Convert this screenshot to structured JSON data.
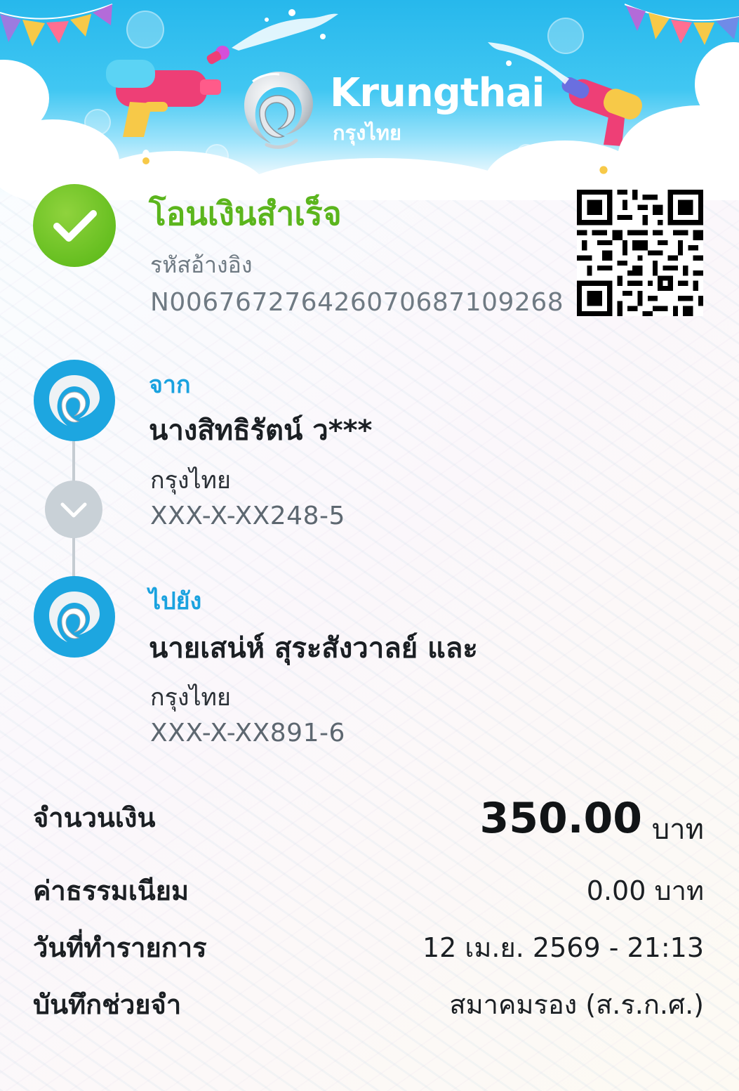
{
  "brand": {
    "name_en": "Krungthai",
    "name_th": "กรุงไทย"
  },
  "status": {
    "title": "โอนเงินสำเร็จ",
    "ref_label": "รหัสอ้างอิง",
    "ref_number": "N006767276426070687109268"
  },
  "from": {
    "label": "จาก",
    "name": "นางสิทธิรัตน์ ว***",
    "bank": "กรุงไทย",
    "account": "XXX-X-XX248-5"
  },
  "to": {
    "label": "ไปยัง",
    "name": "นายเสน่ห์ สุระสังวาลย์ และ",
    "bank": "กรุงไทย",
    "account": "XXX-X-XX891-6"
  },
  "details": {
    "amount_label": "จำนวนเงิน",
    "amount_value": "350.00",
    "amount_unit": "บาท",
    "fee_label": "ค่าธรรมเนียม",
    "fee_value": "0.00 บาท",
    "date_label": "วันที่ทำรายการ",
    "date_value": "12 เม.ย. 2569 - 21:13",
    "memo_label": "บันทึกช่วยจำ",
    "memo_value": "สมาคมรอง (ส.ร.ก.ศ.)"
  },
  "colors": {
    "success_green": "#5bb51d",
    "label_blue": "#1aa2df",
    "brand_blue": "#1da6e0",
    "header_sky": "#27b8ec"
  },
  "icons": {
    "success": "check-circle-icon",
    "bank": "krungthai-bird-icon",
    "flow": "chevron-down-icon",
    "qr": "qr-code-icon"
  }
}
